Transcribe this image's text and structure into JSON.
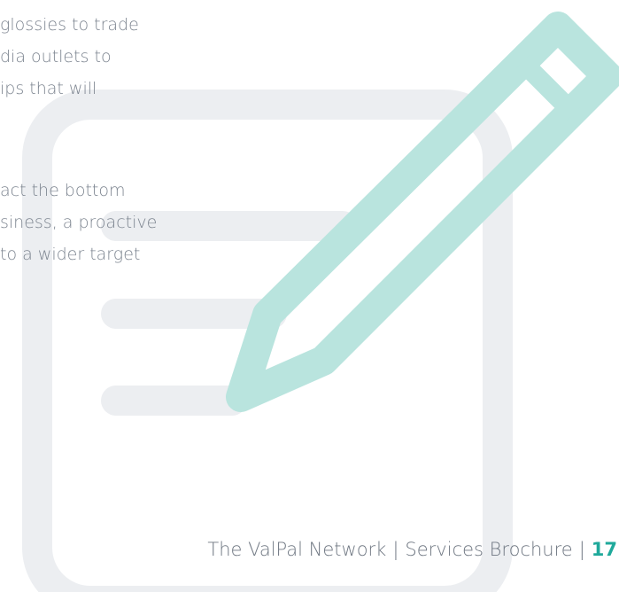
{
  "paragraph_1": {
    "lines": [
      "glossies to trade",
      "dia outlets to",
      "ips that will"
    ]
  },
  "paragraph_2": {
    "lines": [
      "act the bottom",
      "siness, a proactive",
      "to a wider target"
    ]
  },
  "footer": {
    "network": "The ValPal Network",
    "separator": "|",
    "document": "Services Brochure",
    "page_number": "17"
  },
  "icon": {
    "name": "edit-document-icon",
    "outline_color": "#eceef1",
    "pencil_color": "#b9e4de"
  },
  "colors": {
    "body_text": "#7d8590",
    "footer_text": "#6f7782",
    "accent": "#1fa99b"
  }
}
